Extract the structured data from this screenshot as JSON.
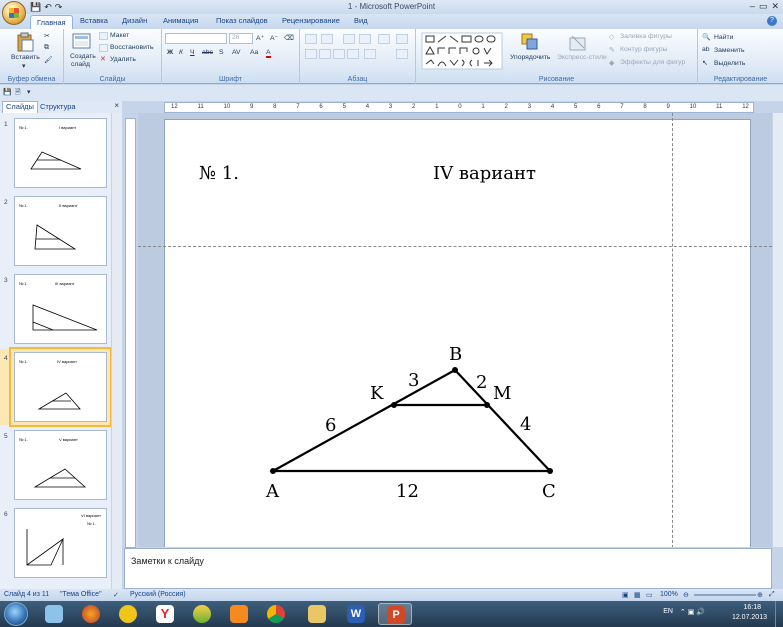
{
  "window": {
    "title": "1 - Microsoft PowerPoint",
    "controls": [
      "–",
      "▭",
      "✕"
    ]
  },
  "ribbon_tabs": [
    "Главная",
    "Вставка",
    "Дизайн",
    "Анимация",
    "Показ слайдов",
    "Рецензирование",
    "Вид"
  ],
  "ribbon": {
    "clipboard": {
      "paste": "Вставить",
      "label": "Буфер обмена"
    },
    "slides": {
      "new_slide_1": "Создать",
      "new_slide_2": "слайд",
      "layout": "Макет",
      "reset": "Восстановить",
      "delete": "Удалить",
      "label": "Слайды"
    },
    "font": {
      "font_name": "",
      "font_size": "28",
      "bold": "Ж",
      "italic": "К",
      "underline": "Ч",
      "strike": "abc",
      "shadow": "S",
      "spacing": "AV",
      "case": "Aa",
      "color": "A",
      "label": "Шрифт"
    },
    "paragraph": {
      "label": "Абзац"
    },
    "drawing": {
      "arrange": "Упорядочить",
      "quick_styles": "Экспресс-стили",
      "fill": "Заливка фигуры",
      "outline": "Контур фигуры",
      "effects": "Эффекты для фигур",
      "label": "Рисование"
    },
    "editing": {
      "find": "Найти",
      "replace": "Заменить",
      "select": "Выделить",
      "label": "Редактирование"
    }
  },
  "slides_pane": {
    "tabs": [
      "Слайды",
      "Структура"
    ],
    "thumbs": [
      {
        "num": "1",
        "t1": "№ 1.",
        "t2": "I вариант"
      },
      {
        "num": "2",
        "t1": "№ 1.",
        "t2": "II вариант"
      },
      {
        "num": "3",
        "t1": "№ 1.",
        "t2": "III вариант"
      },
      {
        "num": "4",
        "t1": "№ 1.",
        "t2": "IV вариант"
      },
      {
        "num": "5",
        "t1": "№ 1.",
        "t2": "V вариант"
      },
      {
        "num": "6",
        "t1": "VI вариант",
        "t2": "№ 1."
      }
    ]
  },
  "ruler": {
    "h_ticks": [
      "12",
      "11",
      "10",
      "9",
      "8",
      "7",
      "6",
      "5",
      "4",
      "3",
      "2",
      "1",
      "0",
      "1",
      "2",
      "3",
      "4",
      "5",
      "6",
      "7",
      "8",
      "9",
      "10",
      "11",
      "12"
    ]
  },
  "slide": {
    "number": "№ 1.",
    "title": "IV вариант",
    "points": {
      "A": "A",
      "B": "B",
      "C": "C",
      "K": "K",
      "M": "M"
    },
    "segments": {
      "AK": "6",
      "KB": "3",
      "BM": "2",
      "MC": "4",
      "AC": "12"
    }
  },
  "notes": {
    "placeholder": "Заметки к слайду"
  },
  "status": {
    "slide_info": "Слайд 4 из 11",
    "theme": "\"Тема Office\"",
    "language": "Русский (Россия)",
    "zoom": "100%"
  },
  "taskbar": {
    "lang": "EN",
    "time": "16:18",
    "date": "12.07.2013"
  }
}
